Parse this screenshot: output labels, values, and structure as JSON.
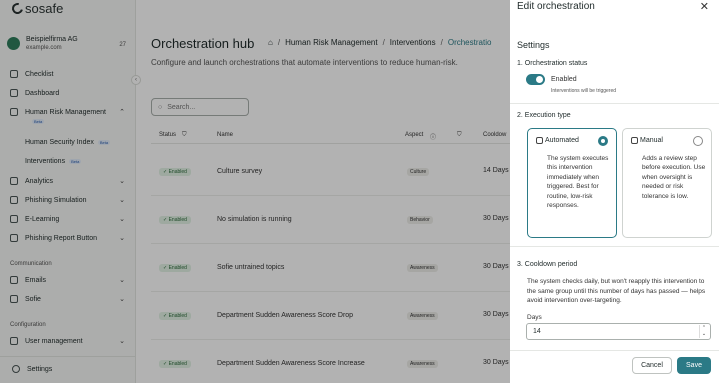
{
  "brand": {
    "logo_text": "sosafe"
  },
  "org": {
    "name": "Beispielfirma AG",
    "domain": "example.com",
    "count": "27"
  },
  "sidebar": {
    "items": [
      {
        "label": "Checklist"
      },
      {
        "label": "Dashboard"
      },
      {
        "label": "Human Risk Management"
      },
      {
        "label": "Analytics"
      },
      {
        "label": "Phishing Simulation"
      },
      {
        "label": "E-Learning"
      },
      {
        "label": "Phishing Report Button"
      },
      {
        "label": "Emails"
      },
      {
        "label": "Sofie"
      },
      {
        "label": "User management"
      },
      {
        "label": "Settings"
      }
    ],
    "sub_items": [
      {
        "label": "Human Security Index",
        "badge": "Beta"
      },
      {
        "label": "Interventions",
        "badge": "Beta"
      }
    ],
    "hrm_badge": "Beta",
    "sections": {
      "communication": "Communication",
      "configuration": "Configuration"
    }
  },
  "main": {
    "title": "Orchestration hub",
    "breadcrumbs": [
      "Human Risk Management",
      "Interventions",
      "Orchestratio"
    ],
    "description": "Configure and launch orchestrations that automate interventions to reduce human-risk.",
    "search_placeholder": "Search...",
    "columns": {
      "status": "Status",
      "name": "Name",
      "aspect": "Aspect",
      "cooldown": "Cooldow"
    },
    "rows": [
      {
        "status": "✓ Enabled",
        "name": "Culture survey",
        "aspect": "Culture",
        "cooldown": "14 Days"
      },
      {
        "status": "✓ Enabled",
        "name": "No simulation is running",
        "aspect": "Behavior",
        "cooldown": "30 Days"
      },
      {
        "status": "✓ Enabled",
        "name": "Sofie untrained topics",
        "aspect": "Awareness",
        "cooldown": "30 Days"
      },
      {
        "status": "✓ Enabled",
        "name": "Department Sudden Awareness Score Drop",
        "aspect": "Awareness",
        "cooldown": "30 Days"
      },
      {
        "status": "✓ Enabled",
        "name": "Department Sudden Awareness Score Increase",
        "aspect": "Awareness",
        "cooldown": "30 Days"
      }
    ]
  },
  "panel": {
    "title": "Edit orchestration",
    "settings_heading": "Settings",
    "status": {
      "heading": "1. Orchestration status",
      "label": "Enabled",
      "hint": "Interventions will be triggered",
      "enabled": true
    },
    "execution": {
      "heading": "2. Execution type",
      "automated": {
        "title": "Automated",
        "description": "The system executes this intervention immediately when triggered. Best for routine, low-risk responses."
      },
      "manual": {
        "title": "Manual",
        "description": "Adds a review step before execution. Use when oversight is needed or risk tolerance is low."
      }
    },
    "cooldown": {
      "heading": "3. Cooldown period",
      "description": "The system checks daily, but won't reapply this intervention to the same group until this number of days has passed — helps avoid intervention over-targeting.",
      "days_label": "Days",
      "days_value": "14"
    },
    "cancel_label": "Cancel",
    "save_label": "Save"
  },
  "colors": {
    "accent": "#2b7a86",
    "enabled_badge": "#e3f2e6"
  }
}
